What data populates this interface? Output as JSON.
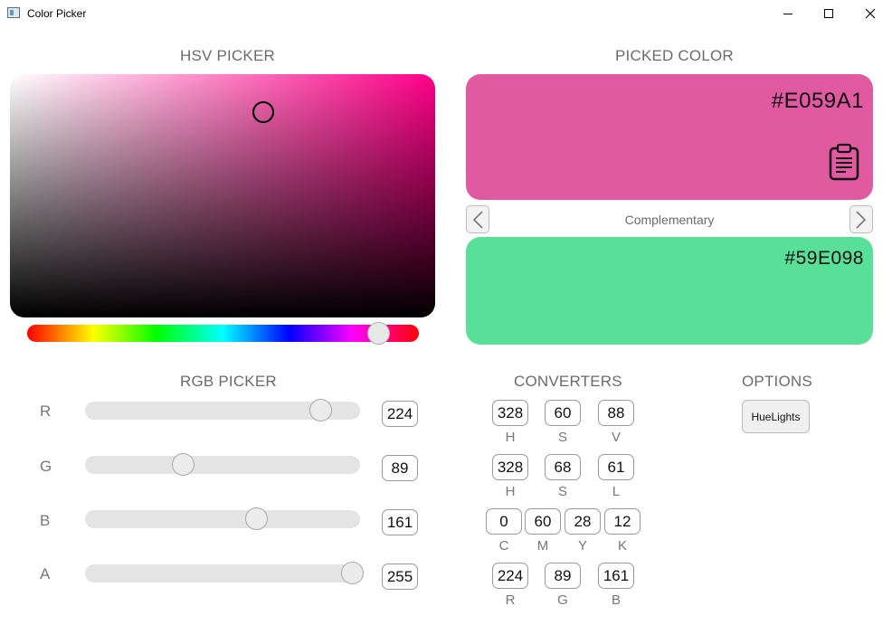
{
  "window": {
    "title": "Color Picker"
  },
  "hsv_picker": {
    "title": "HSV PICKER",
    "hue": 328,
    "saturation": 60,
    "value": 88
  },
  "picked_color": {
    "title": "PICKED COLOR",
    "hex": "#E059A1",
    "color": "#E059A1",
    "scheme": "Complementary",
    "complement_hex": "#59E098",
    "complement_color": "#59E098",
    "prev_label": "<",
    "next_label": ">"
  },
  "rgb_picker": {
    "title": "RGB PICKER",
    "channels": [
      {
        "label": "R",
        "value": "224",
        "fraction": 0.878
      },
      {
        "label": "G",
        "value": "89",
        "fraction": 0.349
      },
      {
        "label": "B",
        "value": "161",
        "fraction": 0.631
      },
      {
        "label": "A",
        "value": "255",
        "fraction": 1.0
      }
    ]
  },
  "converters": {
    "title": "CONVERTERS",
    "hsv": {
      "h": "328",
      "s": "60",
      "v": "88",
      "h_label": "H",
      "s_label": "S",
      "v_label": "V"
    },
    "hsl": {
      "h": "328",
      "s": "68",
      "l": "61",
      "h_label": "H",
      "s_label": "S",
      "l_label": "L"
    },
    "cmyk": {
      "c": "0",
      "m": "60",
      "y": "28",
      "k": "12",
      "c_label": "C",
      "m_label": "M",
      "y_label": "Y",
      "k_label": "K"
    },
    "rgb": {
      "r": "224",
      "g": "89",
      "b": "161",
      "r_label": "R",
      "g_label": "G",
      "b_label": "B"
    }
  },
  "options": {
    "title": "OPTIONS",
    "huelights_label": "HueLights"
  },
  "icons": {
    "clipboard": "clipboard-icon",
    "prev": "chevron-left-icon",
    "next": "chevron-right-icon"
  }
}
